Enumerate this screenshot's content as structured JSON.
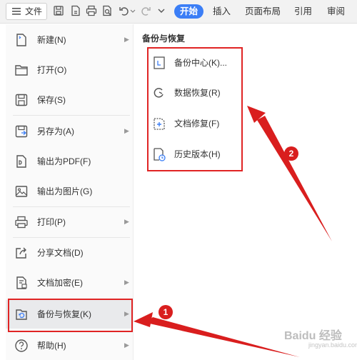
{
  "toolbar": {
    "file_button_label": "文件",
    "tabs": [
      {
        "label": "开始",
        "active": true
      },
      {
        "label": "插入",
        "active": false
      },
      {
        "label": "页面布局",
        "active": false
      },
      {
        "label": "引用",
        "active": false
      },
      {
        "label": "审阅",
        "active": false
      }
    ],
    "icons": [
      "save-icon",
      "export-pdf-icon",
      "print-icon",
      "print-preview-icon",
      "undo-icon",
      "redo-icon",
      "more-dropdown-icon"
    ]
  },
  "file_menu": {
    "items": [
      {
        "label": "新建(N)",
        "icon": "new-document-icon",
        "has_submenu": true
      },
      {
        "label": "打开(O)",
        "icon": "folder-open-icon",
        "has_submenu": false
      },
      {
        "label": "保存(S)",
        "icon": "save-icon",
        "has_submenu": false
      },
      {
        "label": "另存为(A)",
        "icon": "save-as-icon",
        "has_submenu": true
      },
      {
        "label": "输出为PDF(F)",
        "icon": "pdf-icon",
        "has_submenu": false
      },
      {
        "label": "输出为图片(G)",
        "icon": "image-icon",
        "has_submenu": false
      },
      {
        "label": "打印(P)",
        "icon": "print-icon",
        "has_submenu": true
      },
      {
        "label": "分享文档(D)",
        "icon": "share-icon",
        "has_submenu": false
      },
      {
        "label": "文档加密(E)",
        "icon": "encrypt-icon",
        "has_submenu": true
      },
      {
        "label": "备份与恢复(K)",
        "icon": "backup-icon",
        "has_submenu": true,
        "selected": true
      },
      {
        "label": "帮助(H)",
        "icon": "help-icon",
        "has_submenu": true
      }
    ]
  },
  "submenu": {
    "title": "备份与恢复",
    "items": [
      {
        "label": "备份中心(K)...",
        "icon": "backup-center-icon"
      },
      {
        "label": "数据恢复(R)",
        "icon": "data-recovery-icon"
      },
      {
        "label": "文档修复(F)",
        "icon": "document-repair-icon"
      },
      {
        "label": "历史版本(H)",
        "icon": "history-version-icon"
      }
    ]
  },
  "annotations": {
    "badge_1": "1",
    "badge_2": "2",
    "color": "#d91e1e"
  },
  "watermark": {
    "main": "Baidu 经验",
    "sub": "jingyan.baidu.com"
  },
  "colors": {
    "accent": "#3b7ef6",
    "annotation_red": "#e02424",
    "menu_bg": "#fafafa"
  }
}
